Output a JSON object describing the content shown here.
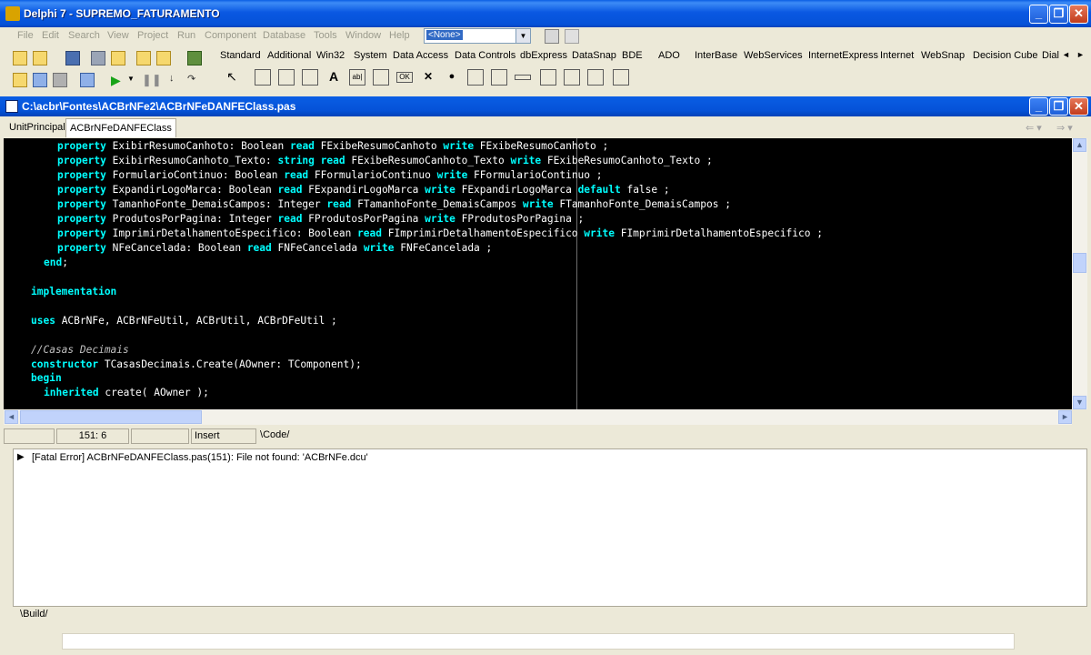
{
  "window": {
    "title": "Delphi 7 - SUPREMO_FATURAMENTO"
  },
  "menu": [
    "File",
    "Edit",
    "Search",
    "View",
    "Project",
    "Run",
    "Component",
    "Database",
    "Tools",
    "Window",
    "Help"
  ],
  "desktop_combo": "<None>",
  "palette_tabs": [
    "Standard",
    "Additional",
    "Win32",
    "System",
    "Data Access",
    "Data Controls",
    "dbExpress",
    "DataSnap",
    "BDE",
    "ADO",
    "InterBase",
    "WebServices",
    "InternetExpress",
    "Internet",
    "WebSnap",
    "Decision Cube",
    "Dial"
  ],
  "palette_labels": {
    "label_a": "A",
    "edit": "ab|",
    "button": "OK",
    "checkbox": "✕",
    "radio": "●"
  },
  "editor": {
    "title": "C:\\acbr\\Fontes\\ACBrNFe2\\ACBrNFeDANFEClass.pas",
    "tabs": [
      "UnitPrincipal",
      "ACBrNFeDANFEClass"
    ]
  },
  "code": {
    "l1": {
      "a": "property",
      "b": " ExibirResumoCanhoto: Boolean ",
      "c": "read",
      "d": " FExibeResumoCanhoto ",
      "e": "write",
      "f": " FExibeResumoCanhoto ;"
    },
    "l2": {
      "a": "property",
      "b": " ExibirResumoCanhoto_Texto: ",
      "c": "string",
      "d": " ",
      "e": "read",
      "f": " FExibeResumoCanhoto_Texto ",
      "g": "write",
      "h": " FExibeResumoCanhoto_Texto ;"
    },
    "l3": {
      "a": "property",
      "b": " FormularioContinuo: Boolean ",
      "c": "read",
      "d": " FFormularioContinuo ",
      "e": "write",
      "f": " FFormularioContinuo ;"
    },
    "l4": {
      "a": "property",
      "b": " ExpandirLogoMarca: Boolean ",
      "c": "read",
      "d": " FExpandirLogoMarca ",
      "e": "write",
      "f": " FExpandirLogoMarca ",
      "g": "default",
      "h": " false ;"
    },
    "l5": {
      "a": "property",
      "b": " TamanhoFonte_DemaisCampos: Integer ",
      "c": "read",
      "d": " FTamanhoFonte_DemaisCampos ",
      "e": "write",
      "f": " FTamanhoFonte_DemaisCampos ;"
    },
    "l6": {
      "a": "property",
      "b": " ProdutosPorPagina: Integer ",
      "c": "read",
      "d": " FProdutosPorPagina ",
      "e": "write",
      "f": " FProdutosPorPagina ;"
    },
    "l7": {
      "a": "property",
      "b": " ImprimirDetalhamentoEspecifico: Boolean ",
      "c": "read",
      "d": " FImprimirDetalhamentoEspecifico ",
      "e": "write",
      "f": " FImprimirDetalhamentoEspecifico ;"
    },
    "l8": {
      "a": "property",
      "b": " NFeCancelada: Boolean ",
      "c": "read",
      "d": " FNFeCancelada ",
      "e": "write",
      "f": " FNFeCancelada ;"
    },
    "l9": {
      "a": "end",
      "b": ";"
    },
    "l10": {
      "a": "implementation"
    },
    "l11": {
      "a": "uses",
      "b": " ACBrNFe, ACBrNFeUtil, ACBrUtil, ACBrDFeUtil ;"
    },
    "l12": {
      "a": "//Casas Decimais"
    },
    "l13": {
      "a": "constructor",
      "b": " TCasasDecimais.Create(AOwner: TComponent);"
    },
    "l14": {
      "a": "begin"
    },
    "l15": {
      "a": "inherited",
      "b": " create( AOwner );"
    }
  },
  "status": {
    "position": "151:  6",
    "mode": "Insert",
    "tab": "Code"
  },
  "messages": [
    "[Fatal Error] ACBrNFeDANFEClass.pas(151): File not found: 'ACBrNFe.dcu'"
  ],
  "bottom_tab": "Build",
  "colors": {
    "keyword": "#00ffff",
    "editor_bg": "#000000",
    "text": "#ffffff"
  }
}
